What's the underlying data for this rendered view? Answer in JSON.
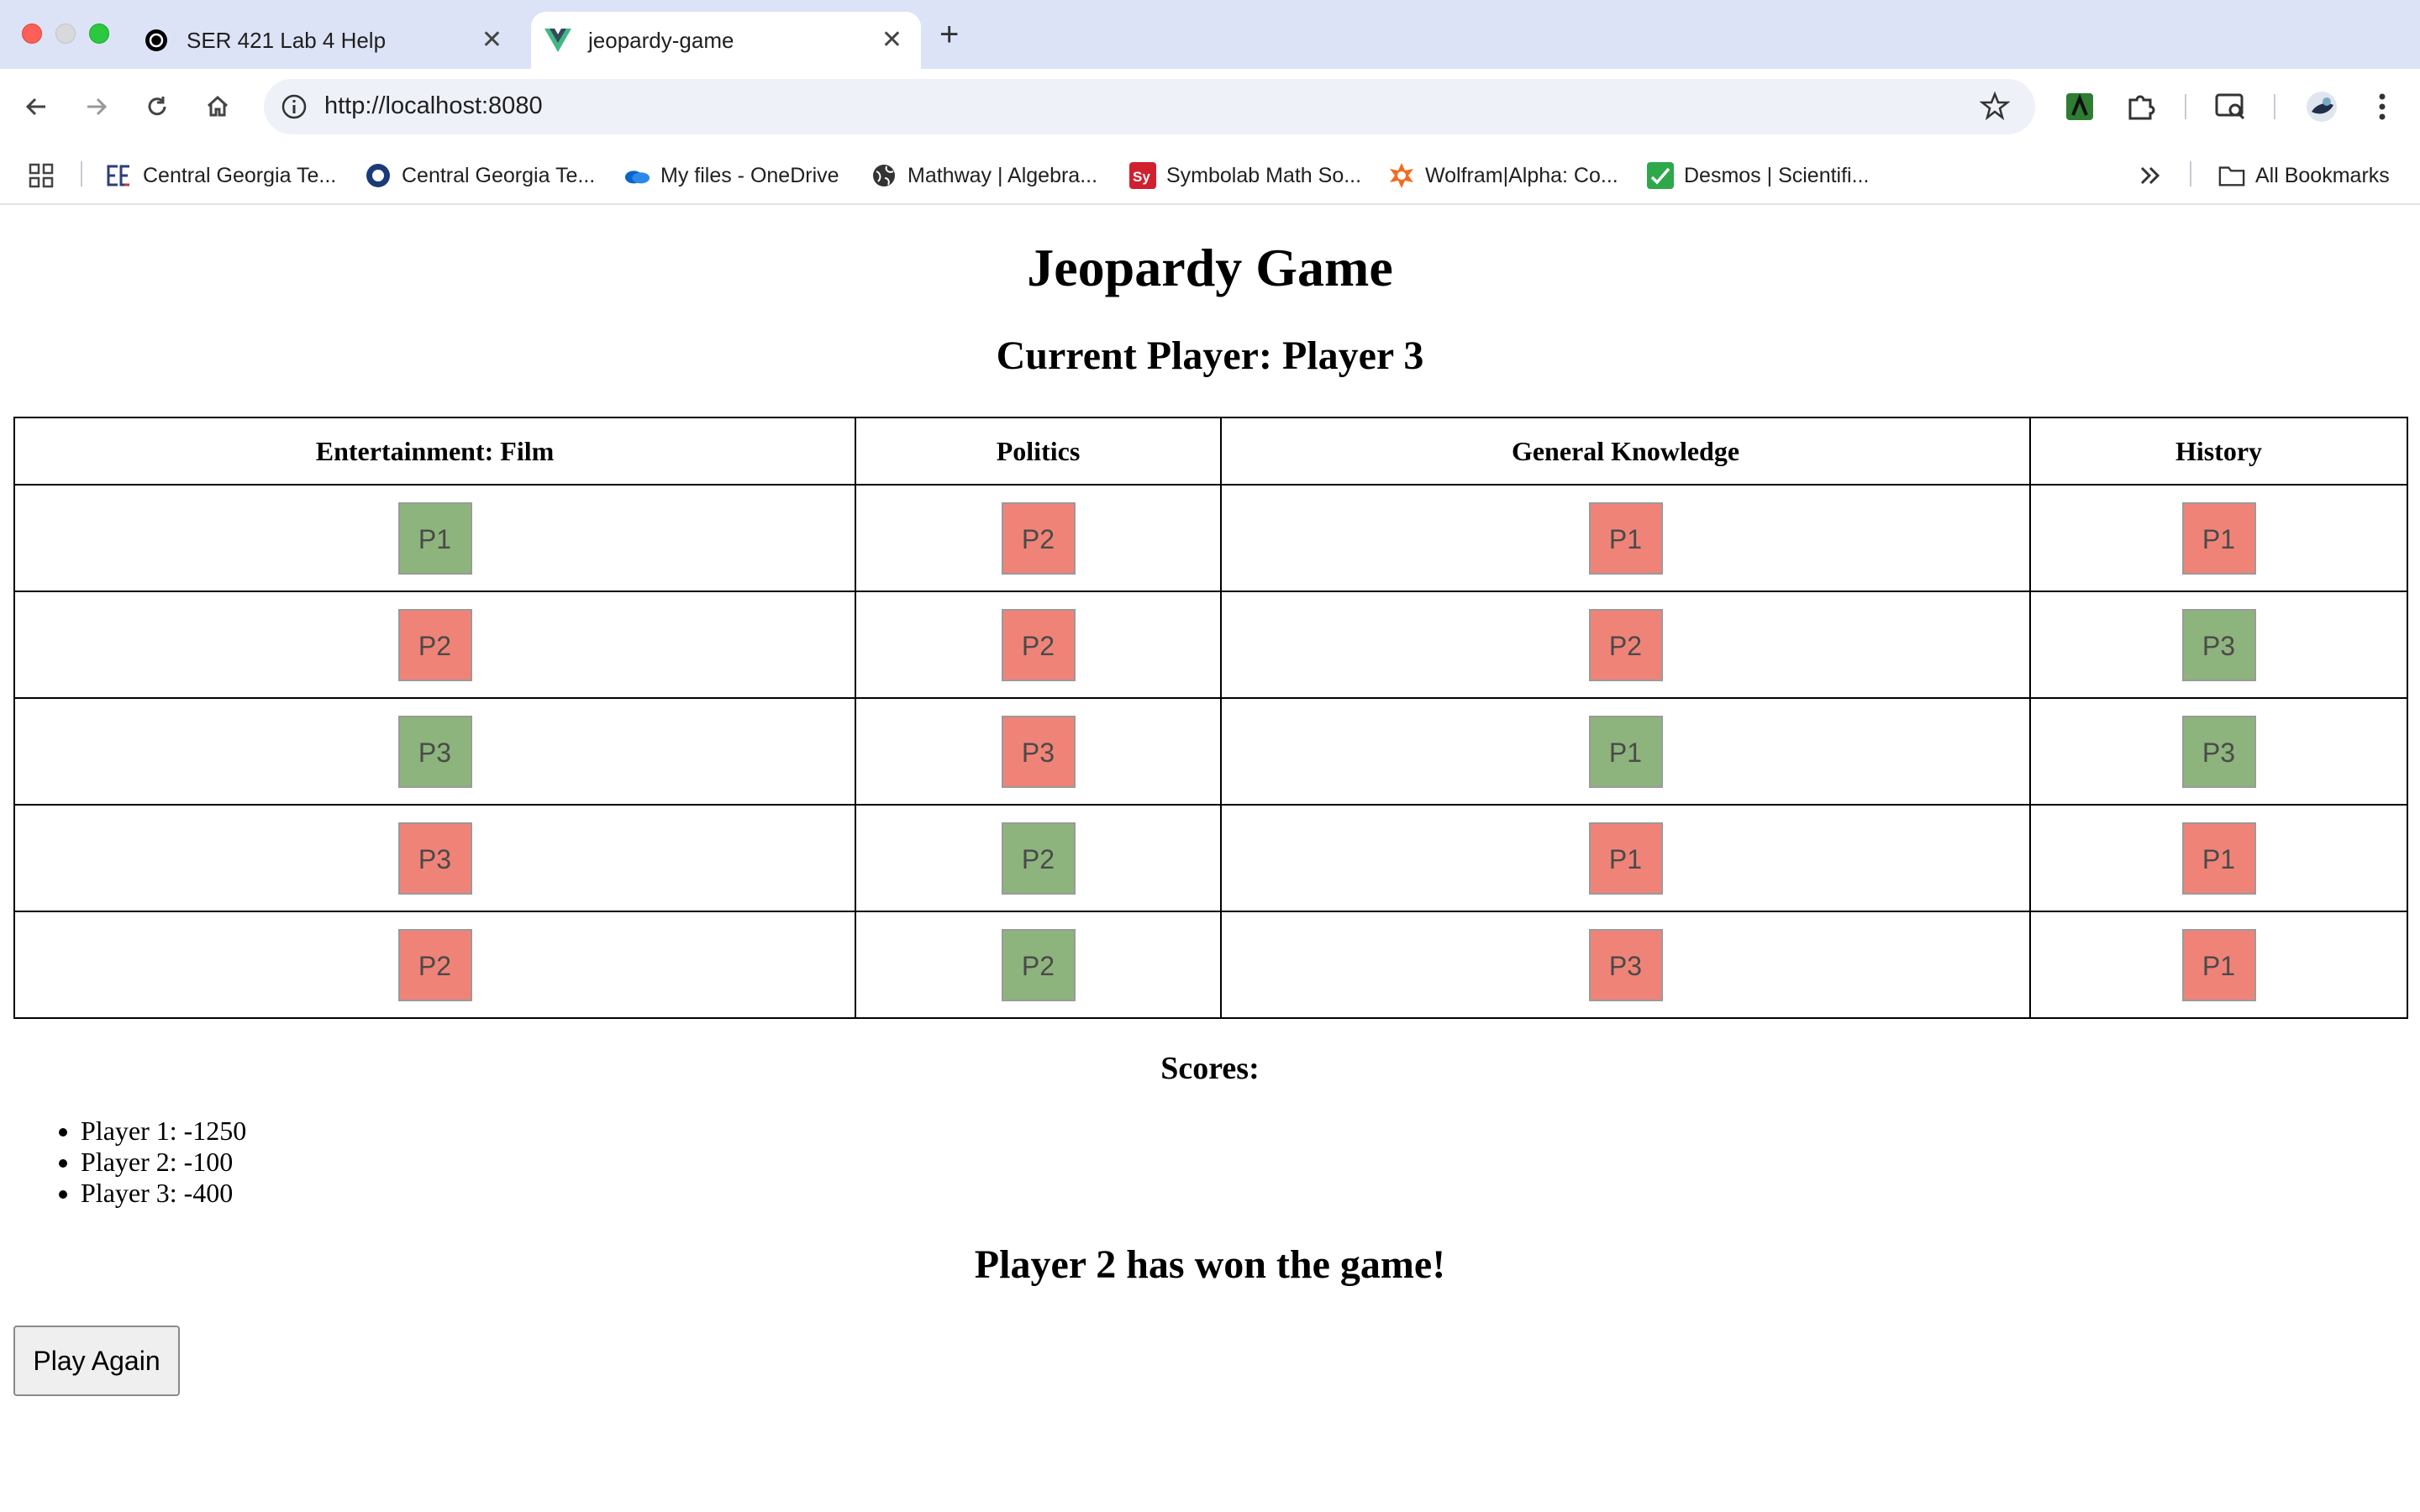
{
  "browser": {
    "tabs": [
      {
        "title": "SER 421 Lab 4 Help",
        "icon": "openai-icon",
        "active": false
      },
      {
        "title": "jeopardy-game",
        "icon": "vue-icon",
        "active": true
      }
    ],
    "url": "http://localhost:8080",
    "bookmarks": [
      {
        "label": "Central Georgia Te...",
        "icon": "cgtc-icon"
      },
      {
        "label": "Central Georgia Te...",
        "icon": "circle-logo-icon"
      },
      {
        "label": "My files - OneDrive",
        "icon": "onedrive-icon"
      },
      {
        "label": "Mathway | Algebra...",
        "icon": "globe-icon"
      },
      {
        "label": "Symbolab Math So...",
        "icon": "symbolab-icon"
      },
      {
        "label": "Wolfram|Alpha: Co...",
        "icon": "wolfram-icon"
      },
      {
        "label": "Desmos | Scientifi...",
        "icon": "desmos-icon"
      }
    ],
    "all_bookmarks_label": "All Bookmarks"
  },
  "game": {
    "title": "Jeopardy Game",
    "current_player": "Current Player: Player 3",
    "categories": [
      "Entertainment: Film",
      "Politics",
      "General Knowledge",
      "History"
    ],
    "rows": [
      [
        {
          "label": "P1",
          "status": "green"
        },
        {
          "label": "P2",
          "status": "red"
        },
        {
          "label": "P1",
          "status": "red"
        },
        {
          "label": "P1",
          "status": "red"
        }
      ],
      [
        {
          "label": "P2",
          "status": "red"
        },
        {
          "label": "P2",
          "status": "red"
        },
        {
          "label": "P2",
          "status": "red"
        },
        {
          "label": "P3",
          "status": "green"
        }
      ],
      [
        {
          "label": "P3",
          "status": "green"
        },
        {
          "label": "P3",
          "status": "red"
        },
        {
          "label": "P1",
          "status": "green"
        },
        {
          "label": "P3",
          "status": "green"
        }
      ],
      [
        {
          "label": "P3",
          "status": "red"
        },
        {
          "label": "P2",
          "status": "green"
        },
        {
          "label": "P1",
          "status": "red"
        },
        {
          "label": "P1",
          "status": "red"
        }
      ],
      [
        {
          "label": "P2",
          "status": "red"
        },
        {
          "label": "P2",
          "status": "green"
        },
        {
          "label": "P3",
          "status": "red"
        },
        {
          "label": "P1",
          "status": "red"
        }
      ]
    ],
    "scores_title": "Scores:",
    "scores": [
      "Player 1: -1250",
      "Player 2: -100",
      "Player 3: -400"
    ],
    "winner": "Player 2 has won the game!",
    "play_again": "Play Again"
  },
  "colors": {
    "correct": "#8db47d",
    "incorrect": "#f08378",
    "tabstrip": "#dde3f6"
  }
}
